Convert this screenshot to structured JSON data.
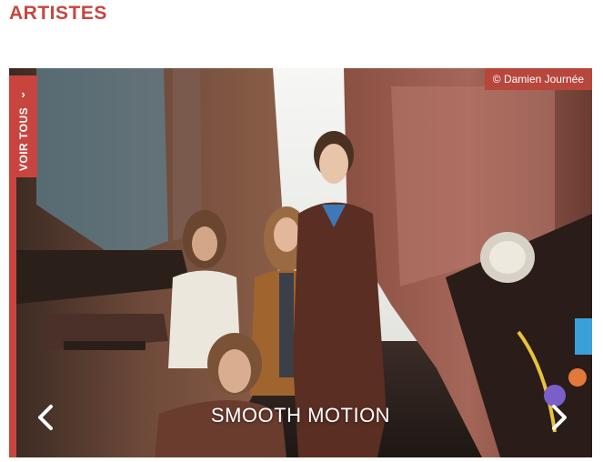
{
  "section": {
    "title": "ARTISTES"
  },
  "carousel": {
    "photo_credit": "© Damien Journée",
    "view_all_label": "VOIR TOUS",
    "view_all_icon": "chevron-right-icon",
    "prev_icon": "chevron-left-icon",
    "next_icon": "chevron-right-icon",
    "slide_caption": "SMOOTH MOTION",
    "accent_color": "#c8453f"
  }
}
